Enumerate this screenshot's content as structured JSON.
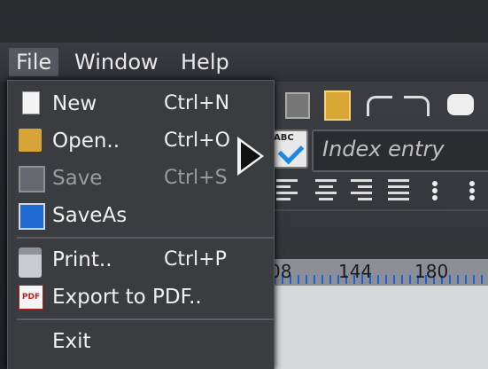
{
  "menubar": {
    "file": "File",
    "window": "Window",
    "help": "Help"
  },
  "file_menu": {
    "items": [
      {
        "label": "New",
        "shortcut": "Ctrl+N",
        "icon": "new-document-icon",
        "enabled": true
      },
      {
        "label": "Open..",
        "shortcut": "Ctrl+O",
        "icon": "open-folder-icon",
        "enabled": true
      },
      {
        "label": "Save",
        "shortcut": "Ctrl+S",
        "icon": "save-disk-icon",
        "enabled": false
      },
      {
        "label": "SaveAs",
        "shortcut": "",
        "icon": "save-as-icon",
        "enabled": true
      },
      {
        "label": "Print..",
        "shortcut": "Ctrl+P",
        "icon": "printer-icon",
        "enabled": true
      },
      {
        "label": "Export to PDF..",
        "shortcut": "",
        "icon": "pdf-export-icon",
        "enabled": true
      },
      {
        "label": "Exit",
        "shortcut": "",
        "icon": "",
        "enabled": true
      }
    ]
  },
  "toolbar": {
    "index_entry_placeholder": "Index entry",
    "spellcheck_label": "ABC"
  },
  "ruler": {
    "marks": [
      "08",
      "144",
      "180"
    ]
  },
  "pdf_icon_text": "PDF"
}
